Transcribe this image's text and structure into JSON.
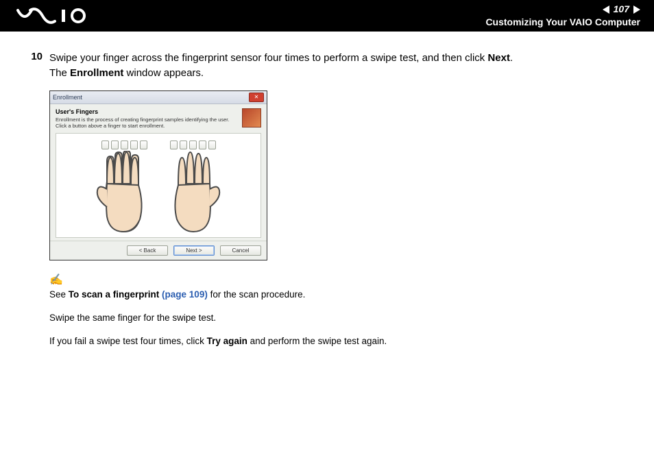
{
  "header": {
    "page_number": "107",
    "section": "Customizing Your VAIO Computer"
  },
  "step": {
    "number": "10",
    "line1_a": "Swipe your finger across the fingerprint sensor four times to perform a swipe test, and then click ",
    "line1_b": "Next",
    "line1_c": ".",
    "line2_a": "The ",
    "line2_b": "Enrollment",
    "line2_c": " window appears."
  },
  "screenshot": {
    "title": "Enrollment",
    "heading": "User's Fingers",
    "desc": "Enrollment is the process of creating fingerprint samples identifying the user. Click a button above a finger to start enrollment.",
    "buttons": {
      "back": "< Back",
      "next": "Next >",
      "cancel": "Cancel"
    }
  },
  "notes": {
    "icon": "✍",
    "n1_a": "See ",
    "n1_b": "To scan a fingerprint ",
    "n1_link": "(page 109)",
    "n1_c": " for the scan procedure.",
    "n2": "Swipe the same finger for the swipe test.",
    "n3_a": "If you fail a swipe test four times, click ",
    "n3_b": "Try again",
    "n3_c": " and perform the swipe test again."
  }
}
